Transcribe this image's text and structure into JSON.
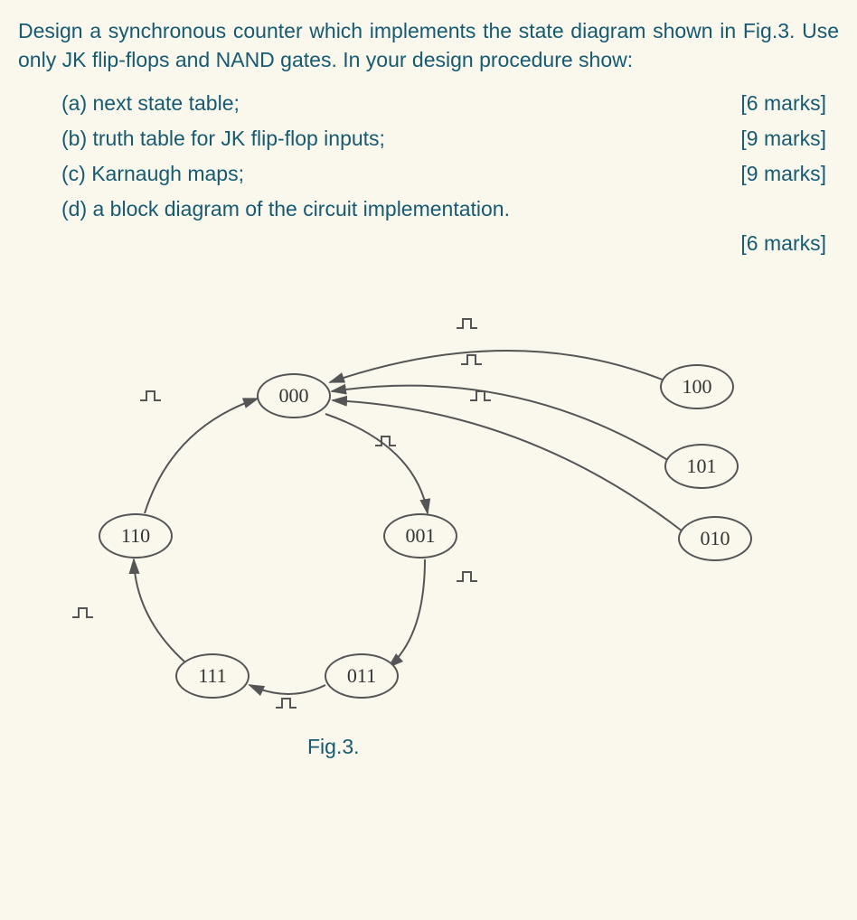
{
  "intro": "Design a synchronous counter which implements the state diagram shown in Fig.3. Use only JK flip-flops and NAND gates. In your design procedure show:",
  "subitems": [
    {
      "label": "(a) next state table;",
      "marks": "[6 marks]"
    },
    {
      "label": "(b) truth table for JK flip-flop inputs;",
      "marks": "[9 marks]"
    },
    {
      "label": "(c) Karnaugh maps;",
      "marks": "[9 marks]"
    },
    {
      "label": "(d) a block diagram of the circuit implementation.",
      "marks": ""
    }
  ],
  "trailing_marks": "[6 marks]",
  "states": {
    "s000": "000",
    "s001": "001",
    "s011": "011",
    "s111": "111",
    "s110": "110",
    "s100": "100",
    "s101": "101",
    "s010": "010"
  },
  "caption": "Fig.3.",
  "diagram": {
    "description": "State diagram of synchronous counter",
    "transitions": [
      {
        "from": "000",
        "to": "001"
      },
      {
        "from": "001",
        "to": "011"
      },
      {
        "from": "011",
        "to": "111"
      },
      {
        "from": "111",
        "to": "110"
      },
      {
        "from": "110",
        "to": "000"
      },
      {
        "from": "100",
        "to": "000"
      },
      {
        "from": "101",
        "to": "000"
      },
      {
        "from": "010",
        "to": "000"
      }
    ]
  }
}
